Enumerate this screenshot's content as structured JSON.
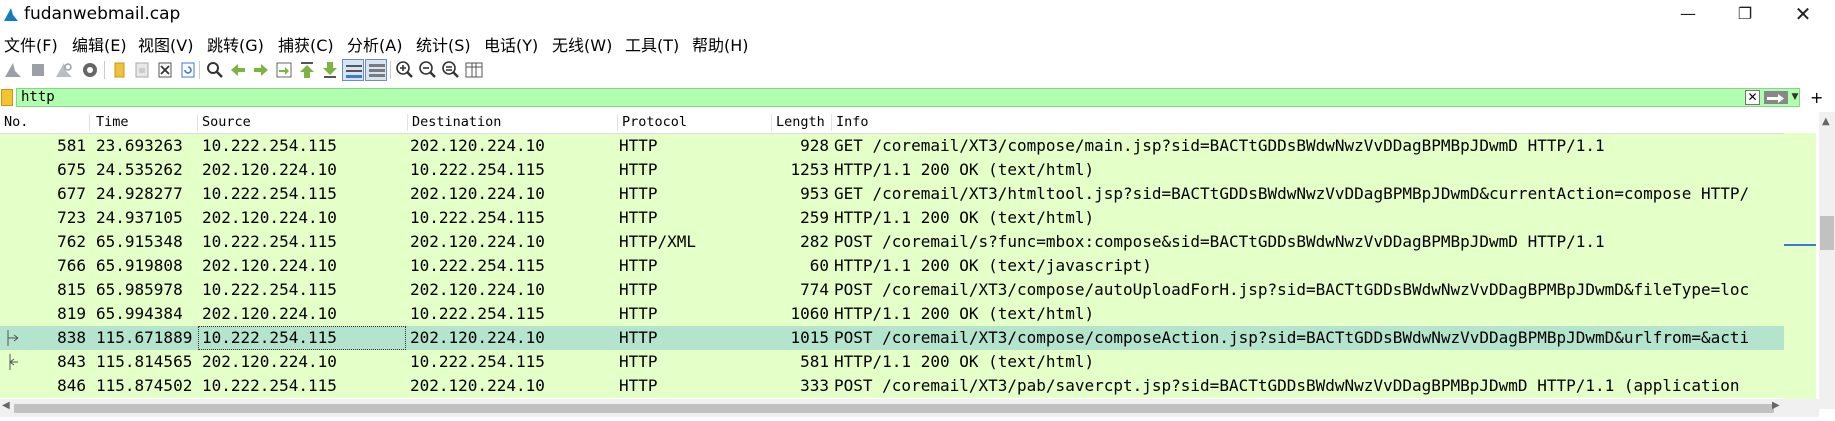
{
  "window": {
    "title": "fudanwebmail.cap",
    "minimize": "—",
    "maximize": "❐",
    "close": "✕"
  },
  "menu": [
    "文件(F)",
    "编辑(E)",
    "视图(V)",
    "跳转(G)",
    "捕获(C)",
    "分析(A)",
    "统计(S)",
    "电话(Y)",
    "无线(W)",
    "工具(T)",
    "帮助(H)"
  ],
  "filter": {
    "value": "http",
    "clear": "✕",
    "dropdown": "▼",
    "add": "+"
  },
  "columns": {
    "no": "No.",
    "time": "Time",
    "source": "Source",
    "destination": "Destination",
    "protocol": "Protocol",
    "length": "Length",
    "info": "Info"
  },
  "packets": [
    {
      "no": "581",
      "time": "23.693263",
      "source": "10.222.254.115",
      "destination": "202.120.224.10",
      "protocol": "HTTP",
      "length": "928",
      "info": "GET /coremail/XT3/compose/main.jsp?sid=BACTtGDDsBWdwNwzVvDDagBPMBpJDwmD HTTP/1.1"
    },
    {
      "no": "675",
      "time": "24.535262",
      "source": "202.120.224.10",
      "destination": "10.222.254.115",
      "protocol": "HTTP",
      "length": "1253",
      "info": "HTTP/1.1 200 OK  (text/html)"
    },
    {
      "no": "677",
      "time": "24.928277",
      "source": "10.222.254.115",
      "destination": "202.120.224.10",
      "protocol": "HTTP",
      "length": "953",
      "info": "GET /coremail/XT3/htmltool.jsp?sid=BACTtGDDsBWdwNwzVvDDagBPMBpJDwmD&currentAction=compose HTTP/"
    },
    {
      "no": "723",
      "time": "24.937105",
      "source": "202.120.224.10",
      "destination": "10.222.254.115",
      "protocol": "HTTP",
      "length": "259",
      "info": "HTTP/1.1 200 OK  (text/html)"
    },
    {
      "no": "762",
      "time": "65.915348",
      "source": "10.222.254.115",
      "destination": "202.120.224.10",
      "protocol": "HTTP/XML",
      "length": "282",
      "info": "POST /coremail/s?func=mbox:compose&sid=BACTtGDDsBWdwNwzVvDDagBPMBpJDwmD HTTP/1.1"
    },
    {
      "no": "766",
      "time": "65.919808",
      "source": "202.120.224.10",
      "destination": "10.222.254.115",
      "protocol": "HTTP",
      "length": "60",
      "info": "HTTP/1.1 200 OK  (text/javascript)"
    },
    {
      "no": "815",
      "time": "65.985978",
      "source": "10.222.254.115",
      "destination": "202.120.224.10",
      "protocol": "HTTP",
      "length": "774",
      "info": "POST /coremail/XT3/compose/autoUploadForH.jsp?sid=BACTtGDDsBWdwNwzVvDDagBPMBpJDwmD&fileType=loc"
    },
    {
      "no": "819",
      "time": "65.994384",
      "source": "202.120.224.10",
      "destination": "10.222.254.115",
      "protocol": "HTTP",
      "length": "1060",
      "info": "HTTP/1.1 200 OK  (text/html)"
    },
    {
      "no": "838",
      "time": "115.671889",
      "source": "10.222.254.115",
      "destination": "202.120.224.10",
      "protocol": "HTTP",
      "length": "1015",
      "info": "POST /coremail/XT3/compose/composeAction.jsp?sid=BACTtGDDsBWdwNwzVvDDagBPMBpJDwmD&urlfrom=&acti"
    },
    {
      "no": "843",
      "time": "115.814565",
      "source": "202.120.224.10",
      "destination": "10.222.254.115",
      "protocol": "HTTP",
      "length": "581",
      "info": "HTTP/1.1 200 OK  (text/html)"
    },
    {
      "no": "846",
      "time": "115.874502",
      "source": "10.222.254.115",
      "destination": "202.120.224.10",
      "protocol": "HTTP",
      "length": "333",
      "info": "POST /coremail/XT3/pab/savercpt.jsp?sid=BACTtGDDsBWdwNwzVvDDagBPMBpJDwmD HTTP/1.1  (application"
    }
  ],
  "selected_index": 8,
  "colors": {
    "http_row": "#e4ffc7",
    "selected_row": "#b5e4cd",
    "filter_valid": "#afffaf"
  },
  "toolbar_icons": [
    "start-capture-icon",
    "stop-capture-icon",
    "restart-capture-icon",
    "capture-options-icon",
    "open-file-icon",
    "save-file-icon",
    "close-file-icon",
    "reload-file-icon",
    "find-packet-icon",
    "go-back-icon",
    "go-forward-icon",
    "go-to-packet-icon",
    "go-first-icon",
    "go-last-icon",
    "auto-scroll-icon",
    "colorize-icon",
    "zoom-in-icon",
    "zoom-out-icon",
    "zoom-normal-icon",
    "resize-columns-icon"
  ]
}
